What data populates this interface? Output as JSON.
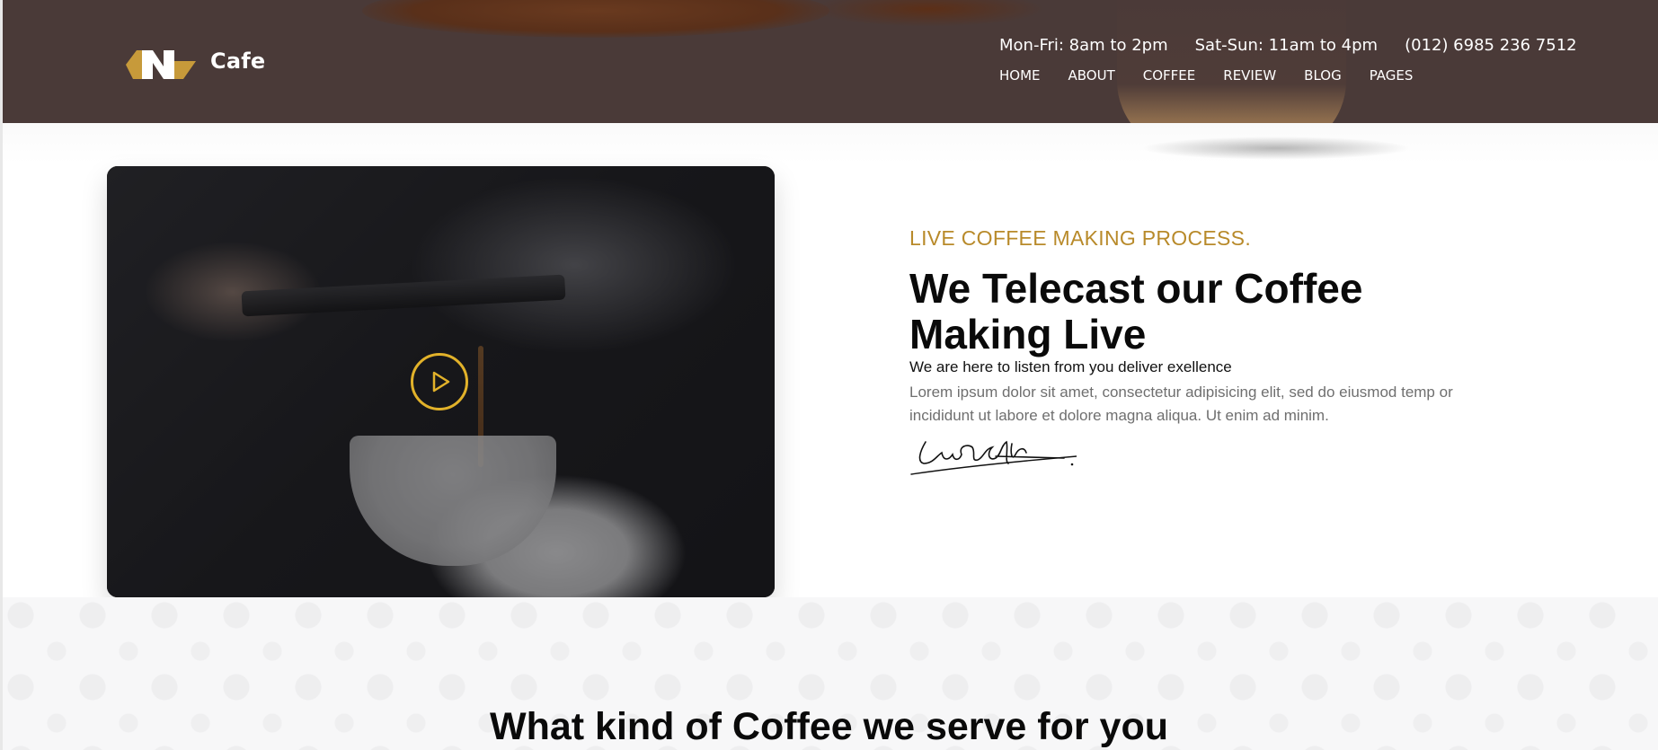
{
  "header": {
    "brand": "Cafe",
    "hours": [
      "Mon-Fri: 8am to 2pm",
      "Sat-Sun: 11am to 4pm",
      "(012) 6985 236 7512"
    ],
    "nav": [
      "HOME",
      "ABOUT",
      "COFFEE",
      "REVIEW",
      "BLOG",
      "PAGES"
    ]
  },
  "hero": {
    "eyebrow": "LIVE COFFEE MAKING PROCESS.",
    "headline": "We Telecast our Coffee Making Live",
    "subline": "We are here to listen from you deliver exellence",
    "body": "Lorem ipsum dolor sit amet, consectetur adipisicing elit, sed do eiusmod temp or incididunt ut labore et dolore magna aliqua. Ut enim ad minim.",
    "signature": "LaraCroft"
  },
  "services": {
    "title": "What kind of Coffee we serve for you"
  },
  "colors": {
    "header_bg": "#4a3a38",
    "accent": "#b88a2a",
    "play_ring": "#e2b22a"
  }
}
